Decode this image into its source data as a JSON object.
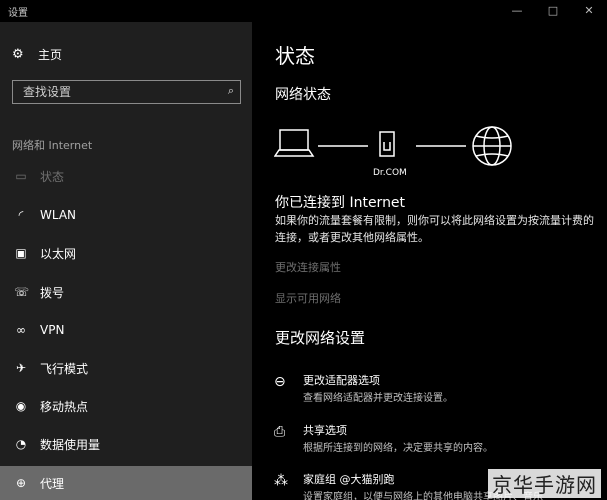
{
  "window": {
    "title": "设置",
    "controls": {
      "minimize": "—",
      "maximize": "□",
      "close": "✕"
    }
  },
  "sidebar": {
    "home_label": "主页",
    "search_placeholder": "查找设置",
    "section_title": "网络和 Internet",
    "items": [
      {
        "label": "状态",
        "icon": "status-icon"
      },
      {
        "label": "WLAN",
        "icon": "wifi-icon"
      },
      {
        "label": "以太网",
        "icon": "ethernet-icon"
      },
      {
        "label": "拨号",
        "icon": "dialup-icon"
      },
      {
        "label": "VPN",
        "icon": "vpn-icon"
      },
      {
        "label": "飞行模式",
        "icon": "airplane-icon"
      },
      {
        "label": "移动热点",
        "icon": "hotspot-icon"
      },
      {
        "label": "数据使用量",
        "icon": "data-usage-icon"
      },
      {
        "label": "代理",
        "icon": "globe-icon"
      }
    ]
  },
  "main": {
    "title": "状态",
    "network_status": "网络状态",
    "router_label": "Dr.COM",
    "connected": "你已连接到 Internet",
    "description": "如果你的流量套餐有限制，则你可以将此网络设置为按流量计费的连接，或者更改其他网络属性。",
    "change_properties": "更改连接属性",
    "show_networks": "显示可用网络",
    "change_settings_title": "更改网络设置",
    "options": [
      {
        "title": "更改适配器选项",
        "desc": "查看网络适配器并更改连接设置。"
      },
      {
        "title": "共享选项",
        "desc": "根据所连接到的网络，决定要共享的内容。"
      },
      {
        "title": "家庭组 @大猫别跑",
        "desc": "设置家庭组，以便与网络上的其他电脑共享图片、音乐"
      }
    ]
  },
  "watermark": "京华手游网",
  "colors": {
    "sidebar_bg": "#1f1f1f",
    "main_bg": "#000000",
    "highlight": "#6a6a6a",
    "disabled": "#6f6f6f"
  }
}
